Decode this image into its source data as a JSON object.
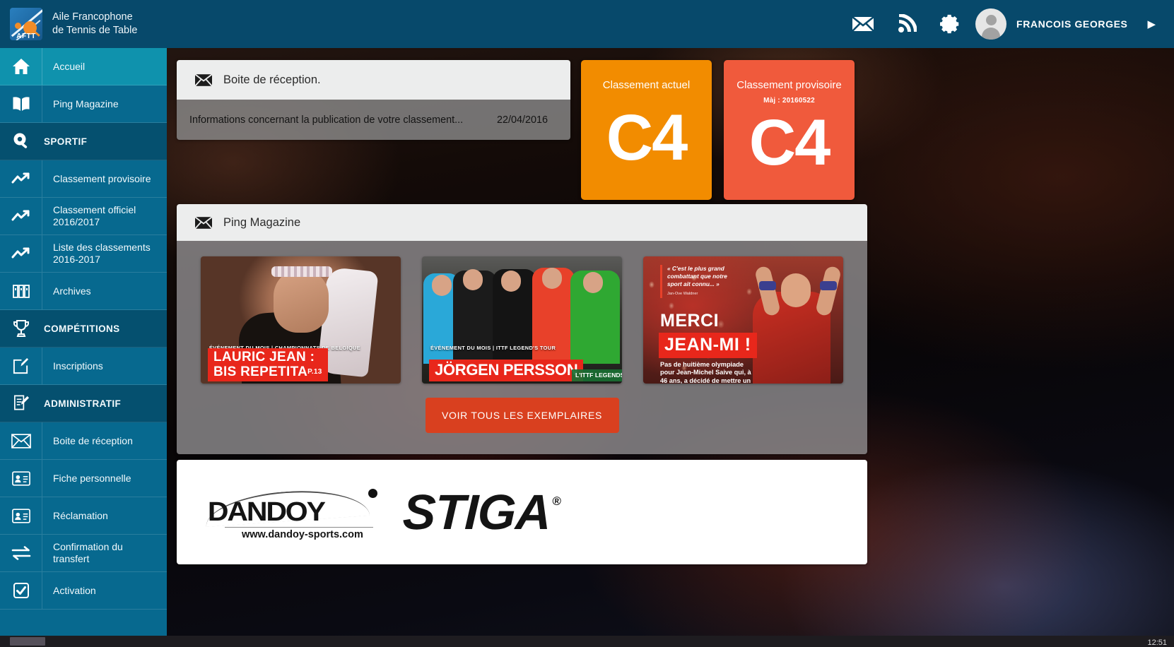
{
  "header": {
    "brand_line1": "Aile Francophone",
    "brand_line2": "de Tennis de Table",
    "logo_text": "AFTT",
    "username": "FRANCOIS GEORGES",
    "icons": [
      "mail-icon",
      "rss-icon",
      "gear-icon",
      "avatar",
      "caret-right-icon"
    ]
  },
  "sidebar": {
    "items": [
      {
        "label": "Accueil",
        "icon": "home-icon",
        "type": "link",
        "active": true
      },
      {
        "label": "Ping Magazine",
        "icon": "book-icon",
        "type": "link",
        "active": false
      },
      {
        "label": "SPORTIF",
        "icon": "paddle-icon",
        "type": "section",
        "active": false
      },
      {
        "label": "Classement provisoire",
        "icon": "trend-icon",
        "type": "link",
        "active": false
      },
      {
        "label": "Classement officiel 2016/2017",
        "icon": "trend-icon",
        "type": "link",
        "active": false
      },
      {
        "label": "Liste des classements 2016-2017",
        "icon": "trend-icon",
        "type": "link",
        "active": false
      },
      {
        "label": "Archives",
        "icon": "archive-icon",
        "type": "link",
        "active": false
      },
      {
        "label": "COMPÉTITIONS",
        "icon": "trophy-icon",
        "type": "section",
        "active": false
      },
      {
        "label": "Inscriptions",
        "icon": "edit-box-icon",
        "type": "link",
        "active": false
      },
      {
        "label": "ADMINISTRATIF",
        "icon": "document-edit-icon",
        "type": "section",
        "active": false
      },
      {
        "label": "Boite de réception",
        "icon": "envelope-icon",
        "type": "link",
        "active": false
      },
      {
        "label": "Fiche personnelle",
        "icon": "id-card-icon",
        "type": "link",
        "active": false
      },
      {
        "label": "Réclamation",
        "icon": "id-card-icon",
        "type": "link",
        "active": false
      },
      {
        "label": "Confirmation du transfert",
        "icon": "transfer-arrows-icon",
        "type": "link",
        "active": false
      },
      {
        "label": "Activation",
        "icon": "checkbox-icon",
        "type": "link",
        "active": false
      }
    ]
  },
  "inbox": {
    "title": "Boite de réception.",
    "icon": "envelope-icon",
    "messages": [
      {
        "subject": "Informations concernant la publication de votre classement...",
        "date": "22/04/2016"
      }
    ]
  },
  "ranking": {
    "current": {
      "title": "Classement actuel",
      "value": "C4",
      "color": "#f28c00"
    },
    "provisional": {
      "title": "Classement provisoire",
      "subtitle": "Màj : 20160522",
      "value": "C4",
      "color": "#f05a3c"
    }
  },
  "magazine": {
    "title": "Ping Magazine",
    "icon": "envelope-icon",
    "see_all_label": "VOIR TOUS LES EXEMPLAIRES",
    "issues": [
      {
        "kicker": "ÉVÉNEMENT DU MOIS | CHAMPIONNATS DE BELGIQUE",
        "title": "LAURIC JEAN :",
        "subtitle": "BIS REPETITA",
        "badge": "P.13"
      },
      {
        "kicker": "ÉVÉNEMENT DU MOIS | ITTF LEGEND'S TOUR",
        "title": "JÖRGEN PERSSON",
        "side_note": "L'ITTF LEGENDS TOUR a de nouveau"
      },
      {
        "quote": "« C'est le plus grand combattant que notre sport ait connu... »",
        "quote_source": "Jan-Ove Waldner",
        "title": "MERCI",
        "highlight": "JEAN-MI !",
        "blurb": "Pas de huitième olympiade pour Jean-Michel Saive qui, à 46 ans, a décidé de mettre un terme à son immense carrière."
      }
    ]
  },
  "sponsors": [
    {
      "name": "DANDOY",
      "url": "www.dandoy-sports.com"
    },
    {
      "name": "STIGA",
      "mark": "®"
    }
  ],
  "taskbar": {
    "clock": "12:51"
  }
}
